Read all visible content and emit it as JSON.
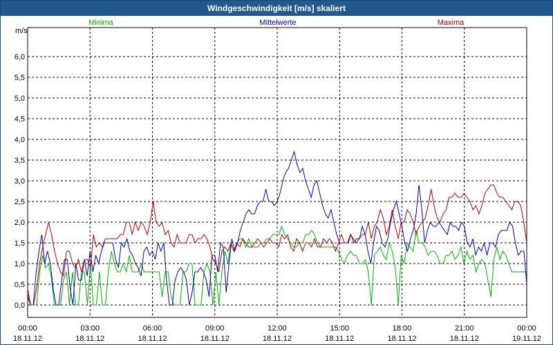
{
  "window": {
    "title": "Windgeschwindigkeit [m/s] skaliert"
  },
  "chart_data": {
    "type": "line",
    "title": "Windgeschwindigkeit [m/s] skaliert",
    "ylabel": "m/s",
    "ylim": [
      -0.3,
      6.7
    ],
    "y_ticks": [
      "0,0",
      "0,5",
      "1,0",
      "1,5",
      "2,0",
      "2,5",
      "3,0",
      "3,5",
      "4,0",
      "4,5",
      "5,0",
      "5,5",
      "6,0"
    ],
    "x_ticks": [
      {
        "time": "00:00",
        "date": "18.11.12"
      },
      {
        "time": "03:00",
        "date": "18.11.12"
      },
      {
        "time": "06:00",
        "date": "18.11.12"
      },
      {
        "time": "09:00",
        "date": "18.11.12"
      },
      {
        "time": "12:00",
        "date": "18.11.12"
      },
      {
        "time": "15:00",
        "date": "18.11.12"
      },
      {
        "time": "18:00",
        "date": "18.11.12"
      },
      {
        "time": "21:00",
        "date": "18.11.12"
      },
      {
        "time": "00:00",
        "date": "19.11.12"
      }
    ],
    "xlim_hours": [
      0,
      24
    ],
    "grid": true,
    "legend_position": "top",
    "series": [
      {
        "name": "Minima",
        "color": "#00b000",
        "values": [
          0.3,
          0.0,
          0.0,
          0.0,
          0.8,
          1.2,
          0.9,
          1.0,
          0.6,
          0.0,
          0.0,
          0.0,
          0.6,
          0.8,
          0.0,
          0.8,
          0.0,
          0.0,
          0.8,
          0.8,
          0.0,
          1.0,
          0.0,
          0.0,
          0.8,
          0.0,
          0.0,
          0.8,
          1.3,
          1.0,
          0.8,
          0.8,
          1.0,
          0.8,
          1.2,
          0.8,
          0.8,
          0.8,
          1.0,
          0.8,
          0.8,
          0.8,
          0.8,
          0.8,
          0.8,
          0.2,
          0.8,
          0.8,
          0.2,
          0.0,
          0.0,
          0.0,
          0.8,
          0.8,
          1.0,
          1.0,
          0.0,
          0.0,
          0.0,
          0.8,
          1.0,
          0.8,
          0.0,
          0.8,
          0.0,
          0.8,
          1.3,
          1.0,
          1.5,
          1.3,
          1.5,
          1.6,
          1.6,
          1.4,
          1.6,
          1.4,
          1.4,
          1.4,
          1.5,
          1.5,
          1.6,
          1.6,
          1.7,
          1.7,
          1.7,
          1.9,
          1.7,
          1.6,
          1.5,
          1.4,
          1.4,
          1.5,
          1.5,
          1.7,
          1.7,
          1.8,
          1.7,
          1.5,
          1.4,
          1.4,
          1.4,
          1.4,
          1.4,
          1.4,
          1.3,
          1.1,
          1.0,
          1.2,
          1.3,
          1.2,
          1.2,
          1.0,
          1.0,
          1.1,
          0.8,
          0.0,
          1.2,
          1.3,
          1.4,
          1.2,
          1.1,
          1.5,
          1.3,
          0.9,
          0.0,
          1.2,
          1.0,
          1.5,
          1.4,
          1.3,
          1.8,
          1.5,
          1.5,
          1.4,
          1.2,
          1.3,
          1.3,
          1.2,
          1.0,
          1.0,
          1.2,
          1.2,
          1.3,
          1.1,
          1.2,
          1.4,
          1.0,
          1.3,
          1.1,
          1.2,
          0.8,
          1.0,
          1.1,
          1.0,
          0.6,
          0.2,
          1.1,
          1.4,
          1.1,
          1.3,
          1.2,
          1.0,
          0.8,
          0.8,
          0.8,
          0.8,
          0.8,
          0.8
        ]
      },
      {
        "name": "Mittelwerte",
        "color": "#0000b0",
        "values": [
          0.2,
          0.0,
          0.0,
          0.8,
          1.3,
          1.7,
          1.0,
          1.3,
          1.0,
          0.4,
          0.0,
          0.0,
          0.6,
          1.1,
          1.1,
          0.4,
          0.0,
          1.0,
          0.6,
          0.6,
          1.1,
          0.7,
          1.3,
          0.8,
          1.2,
          1.0,
          1.3,
          1.5,
          1.5,
          1.5,
          1.5,
          1.1,
          0.9,
          1.5,
          1.4,
          1.6,
          1.3,
          1.2,
          1.0,
          0.9,
          0.7,
          1.3,
          1.4,
          1.2,
          1.3,
          1.1,
          1.5,
          1.3,
          1.5,
          0.6,
          0.0,
          0.0,
          0.6,
          0.8,
          0.9,
          0.8,
          0.6,
          0.0,
          0.3,
          0.8,
          0.8,
          0.9,
          0.8,
          0.6,
          0.2,
          1.2,
          1.2,
          0.8,
          1.5,
          1.4,
          0.3,
          1.0,
          1.6,
          1.3,
          1.5,
          1.8,
          2.0,
          2.2,
          2.3,
          2.2,
          2.2,
          2.4,
          2.5,
          2.5,
          2.8,
          2.5,
          2.5,
          2.4,
          2.5,
          2.7,
          3.0,
          3.2,
          3.3,
          3.5,
          3.7,
          3.4,
          3.2,
          3.3,
          3.0,
          2.8,
          2.6,
          2.9,
          3.0,
          2.7,
          2.4,
          2.2,
          2.1,
          2.3,
          2.0,
          1.7,
          1.5,
          1.5,
          1.5,
          1.5,
          1.7,
          1.5,
          1.6,
          1.6,
          1.9,
          1.7,
          1.3,
          1.0,
          1.5,
          1.9,
          1.8,
          1.5,
          1.4,
          1.6,
          2.0,
          2.3,
          2.5,
          2.2,
          1.9,
          1.5,
          1.3,
          1.6,
          1.8,
          2.2,
          2.9,
          2.3,
          1.5,
          1.8,
          2.0,
          1.9,
          1.9,
          2.0,
          1.9,
          1.8,
          1.7,
          2.0,
          1.9,
          1.9,
          1.8,
          2.0,
          1.9,
          1.5,
          1.4,
          1.6,
          1.2,
          1.4,
          1.3,
          1.5,
          1.2,
          1.5,
          1.5,
          1.4,
          1.7,
          1.8,
          1.8,
          1.8,
          2.0,
          1.9,
          1.5,
          1.2,
          1.3,
          1.3,
          0.5
        ]
      },
      {
        "name": "Maxima",
        "color": "#b00000",
        "values": [
          0.4,
          0.0,
          0.0,
          0.4,
          1.0,
          1.4,
          1.7,
          2.0,
          1.7,
          1.3,
          1.0,
          0.8,
          0.7,
          1.3,
          1.3,
          1.0,
          0.9,
          1.1,
          0.8,
          1.1,
          1.1,
          0.9,
          1.7,
          1.4,
          1.5,
          1.4,
          1.6,
          1.6,
          1.6,
          1.6,
          1.6,
          1.7,
          1.7,
          2.0,
          2.0,
          1.7,
          2.0,
          1.8,
          2.0,
          1.9,
          1.7,
          2.0,
          2.5,
          2.0,
          1.9,
          2.0,
          1.7,
          1.8,
          1.5,
          1.4,
          1.7,
          1.5,
          1.5,
          1.5,
          1.7,
          1.7,
          1.5,
          1.6,
          1.6,
          1.7,
          1.6,
          1.4,
          1.1,
          1.0,
          0.8,
          1.3,
          1.4,
          1.3,
          1.5,
          1.3,
          1.5,
          1.4,
          1.6,
          1.5,
          1.4,
          1.4,
          1.5,
          1.6,
          1.5,
          1.4,
          1.5,
          1.6,
          1.5,
          1.5,
          1.4,
          1.7,
          1.6,
          1.7,
          1.4,
          1.3,
          1.6,
          1.5,
          1.3,
          1.5,
          1.5,
          1.4,
          1.6,
          1.4,
          1.4,
          1.6,
          1.5,
          1.6,
          1.5,
          1.3,
          1.5,
          1.7,
          1.5,
          1.5,
          1.7,
          1.6,
          1.5,
          1.6,
          1.7,
          1.7,
          2.0,
          1.6,
          1.9,
          2.0,
          2.3,
          2.1,
          1.7,
          1.9,
          2.3,
          1.9,
          1.6,
          2.0,
          2.0,
          2.3,
          2.2,
          2.0,
          1.7,
          1.9,
          2.0,
          2.1,
          2.4,
          2.8,
          2.4,
          2.1,
          2.0,
          2.2,
          2.3,
          2.6,
          2.6,
          2.7,
          2.6,
          2.6,
          2.7,
          2.6,
          2.5,
          2.3,
          2.4,
          2.2,
          2.4,
          2.7,
          2.8,
          2.9,
          2.9,
          2.7,
          2.6,
          2.6,
          2.5,
          2.4,
          2.3,
          2.5,
          2.5,
          2.4,
          2.0,
          1.5
        ]
      }
    ]
  },
  "legend": {
    "min_label": "Minima",
    "mean_label": "Mittelwerte",
    "max_label": "Maxima"
  }
}
